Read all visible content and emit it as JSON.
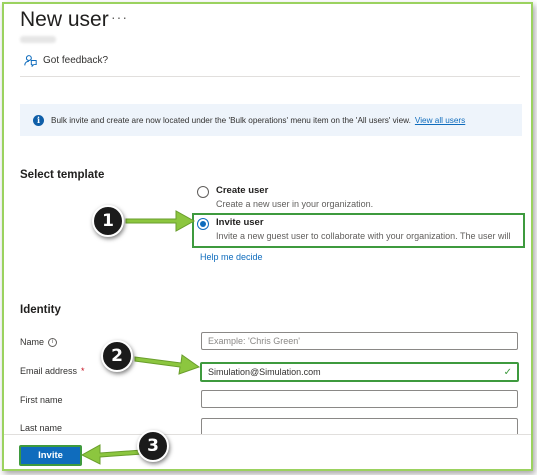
{
  "header": {
    "title": "New user",
    "more_label": "···",
    "feedback_label": "Got feedback?"
  },
  "banner": {
    "text": "Bulk invite and create are now located under the 'Bulk operations' menu item on the 'All users' view.",
    "link": "View all users"
  },
  "template": {
    "heading": "Select template",
    "options": [
      {
        "title": "Create user",
        "desc": "Create a new user in your organization.",
        "selected": false
      },
      {
        "title": "Invite user",
        "desc": "Invite a new guest user to collaborate with your organization. The user will",
        "selected": true
      }
    ],
    "help_link": "Help me decide"
  },
  "identity": {
    "heading": "Identity",
    "fields": [
      {
        "label": "Name",
        "value": "",
        "placeholder": "Example: 'Chris Green'"
      },
      {
        "label": "Email address",
        "required": "*",
        "value": "Simulation@Simulation.com",
        "placeholder": ""
      },
      {
        "label": "First name",
        "value": "",
        "placeholder": ""
      },
      {
        "label": "Last name",
        "value": "",
        "placeholder": ""
      }
    ]
  },
  "footer": {
    "invite_label": "Invite"
  },
  "steps": [
    "1",
    "2",
    "3"
  ],
  "colors": {
    "accent": "#0f6cbd",
    "highlight": "#3e9a3e",
    "arrow": "#8cc63f",
    "banner_bg": "#eef4fb"
  }
}
